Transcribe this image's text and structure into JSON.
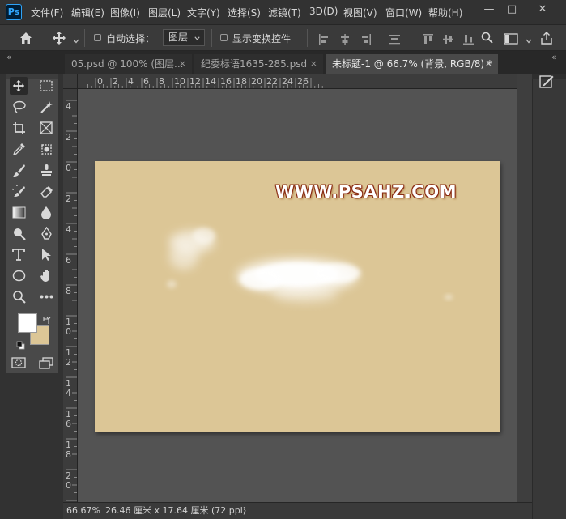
{
  "app": {
    "logo_text": "Ps"
  },
  "menu": [
    "文件(F)",
    "编辑(E)",
    "图像(I)",
    "图层(L)",
    "文字(Y)",
    "选择(S)",
    "滤镜(T)",
    "3D(D)",
    "视图(V)",
    "窗口(W)",
    "帮助(H)"
  ],
  "window_controls": {
    "minimize": "—",
    "maximize": "□",
    "close": "✕"
  },
  "options": {
    "auto_select_label": "自动选择：",
    "auto_select_checked": false,
    "layer_select_value": "图层",
    "show_transform_label": "显示变换控件",
    "show_transform_checked": false
  },
  "tabs": [
    {
      "label": "05.psd @ 100% (图层...",
      "close": "×",
      "active": false
    },
    {
      "label": "纪委标语1635-285.psd",
      "close": "×",
      "active": false
    },
    {
      "label": "未标题-1 @ 66.7% (背景, RGB/8) *",
      "close": "×",
      "active": true
    }
  ],
  "ruler_top": [
    "0",
    "2",
    "4",
    "6",
    "8",
    "10",
    "12",
    "14",
    "16",
    "18",
    "20",
    "22",
    "24",
    "26"
  ],
  "ruler_left": [
    "4",
    "2",
    "0",
    "2",
    "4",
    "6",
    "8",
    "10",
    "12",
    "14",
    "16",
    "18",
    "20"
  ],
  "canvas": {
    "background_color": "#dcc696",
    "watermark_text": "WWW.PSAHZ.COM"
  },
  "colors": {
    "foreground": "#ffffff",
    "background": "#dcc696",
    "accent": "#31a8ff"
  },
  "status": {
    "zoom": "66.67%",
    "doc_info": "26.46 厘米 x 17.64 厘米 (72 ppi)",
    "arrow": "›"
  },
  "collapse_left": "«",
  "collapse_right": "«"
}
